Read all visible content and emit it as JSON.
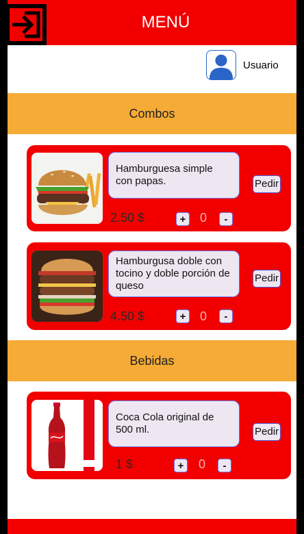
{
  "header": {
    "title": "MENÚ",
    "logout_icon": "logout-arrow-icon",
    "color": "#f20000"
  },
  "user": {
    "name": "Usuario",
    "avatar_icon": "user-avatar-icon"
  },
  "sections": [
    {
      "title": "Combos",
      "items": [
        {
          "description": "Hamburguesa simple con papas.",
          "price": "2.50 $",
          "quantity": "0",
          "order_label": "Pedir",
          "plus_label": "+",
          "minus_label": "-"
        },
        {
          "description": "Hamburgusa doble con tocino y doble porción de queso",
          "price": "4.50 $",
          "quantity": "0",
          "order_label": "Pedir",
          "plus_label": "+",
          "minus_label": "-"
        }
      ]
    },
    {
      "title": "Bebidas",
      "items": [
        {
          "description": "Coca Cola original de 500 ml.",
          "price": "1 $",
          "quantity": "0",
          "order_label": "Pedir",
          "plus_label": "+",
          "minus_label": "-"
        }
      ]
    }
  ],
  "colors": {
    "primary_red": "#f20000",
    "section_orange": "#f5ab36",
    "control_fill": "#eee6f1",
    "control_border": "#6e7cf0"
  }
}
